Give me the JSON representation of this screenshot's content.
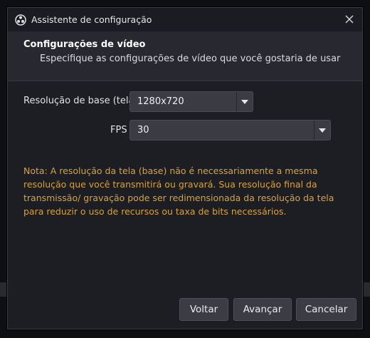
{
  "window": {
    "title": "Assistente de configuração"
  },
  "header": {
    "title": "Configurações de vídeo",
    "subtitle": "Especifique as configurações de vídeo que você gostaria de usar"
  },
  "form": {
    "base_resolution": {
      "label": "Resolução de base (tela)",
      "value": "1280x720"
    },
    "fps": {
      "label": "FPS",
      "value": "30"
    }
  },
  "note": "Nota: A resolução da tela (base) não é necessariamente a mesma resolução que você transmitirá ou gravará. Sua resolução final da transmissão/ gravação pode ser redimensionada da resolução da tela para reduzir o uso de recursos ou taxa de bits necessários.",
  "buttons": {
    "back": "Voltar",
    "next": "Avançar",
    "cancel": "Cancelar"
  },
  "colors": {
    "note_text": "#d7a23a",
    "dialog_bg": "#1d1e24",
    "header_bg": "#272830"
  }
}
